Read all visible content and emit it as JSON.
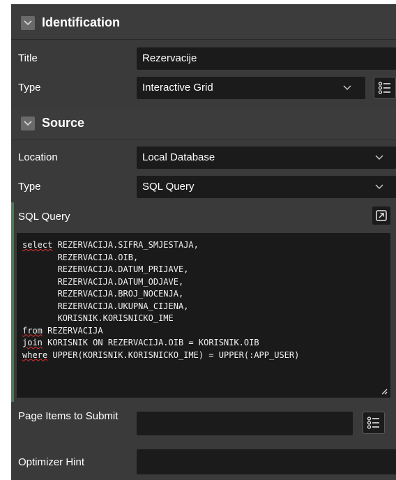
{
  "identification": {
    "header": "Identification",
    "title_label": "Title",
    "title_value": "Rezervacije",
    "type_label": "Type",
    "type_value": "Interactive Grid"
  },
  "source": {
    "header": "Source",
    "location_label": "Location",
    "location_value": "Local Database",
    "type_label": "Type",
    "type_value": "SQL Query",
    "sql_label": "SQL Query",
    "sql_lines": [
      "select REZERVACIJA.SIFRA_SMJESTAJA,",
      "       REZERVACIJA.OIB,",
      "       REZERVACIJA.DATUM_PRIJAVE,",
      "       REZERVACIJA.DATUM_ODJAVE,",
      "       REZERVACIJA.BROJ_NOCENJA,",
      "       REZERVACIJA.UKUPNA_CIJENA,",
      "       KORISNIK.KORISNICKO_IME",
      "from REZERVACIJA",
      "join KORISNIK ON REZERVACIJA.OIB = KORISNIK.OIB",
      "where UPPER(KORISNIK.KORISNICKO_IME) = UPPER(:APP_USER)"
    ],
    "page_items_label": "Page Items to Submit",
    "page_items_value": "",
    "optimizer_label": "Optimizer Hint",
    "optimizer_value": ""
  },
  "icons": {
    "collapse": "chevron-down-icon",
    "list": "list-icon",
    "expand": "expand-icon",
    "resize": "resize-grip-icon"
  },
  "colors": {
    "panel_bg": "#3a3a3a",
    "field_bg": "#1b1b1b",
    "accent_green": "#4c7a52",
    "squiggle": "#dd3333"
  }
}
